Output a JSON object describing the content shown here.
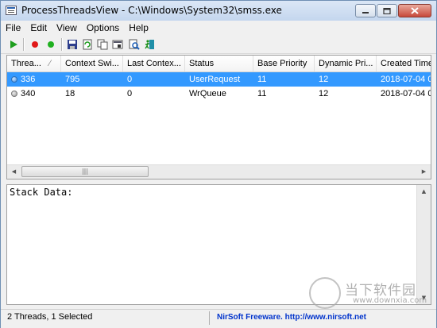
{
  "window": {
    "title": "ProcessThreadsView -  C:\\Windows\\System32\\smss.exe"
  },
  "menu": [
    {
      "label": "File"
    },
    {
      "label": "Edit"
    },
    {
      "label": "View"
    },
    {
      "label": "Options"
    },
    {
      "label": "Help"
    }
  ],
  "toolbar": {
    "icons": [
      "play-icon",
      "red-dot-icon",
      "green-dot-icon",
      "save-icon",
      "refresh-icon",
      "copy-icon",
      "properties-icon",
      "find-icon",
      "exit-icon"
    ]
  },
  "table": {
    "columns": [
      {
        "label": "Threa..."
      },
      {
        "label": "Context Swi..."
      },
      {
        "label": "Last Contex..."
      },
      {
        "label": "Status"
      },
      {
        "label": "Base Priority"
      },
      {
        "label": "Dynamic Pri..."
      },
      {
        "label": "Created Time"
      }
    ],
    "rows": [
      {
        "status_color": "blue",
        "cells": [
          "336",
          "795",
          "0",
          "UserRequest",
          "11",
          "12",
          "2018-07-04 0"
        ],
        "selected": true
      },
      {
        "status_color": "gray",
        "cells": [
          "340",
          "18",
          "0",
          "WrQueue",
          "11",
          "12",
          "2018-07-04 0"
        ],
        "selected": false
      }
    ]
  },
  "stack": {
    "label": "Stack Data:"
  },
  "status": {
    "count_text": "2 Threads, 1 Selected",
    "nirsoft_text": "NirSoft Freeware.  http://www.nirsoft.net"
  },
  "watermark": {
    "title": "当下软件园",
    "url": "www.downxia.com"
  },
  "colors": {
    "selection": "#3399ff",
    "link": "#0033cc"
  }
}
